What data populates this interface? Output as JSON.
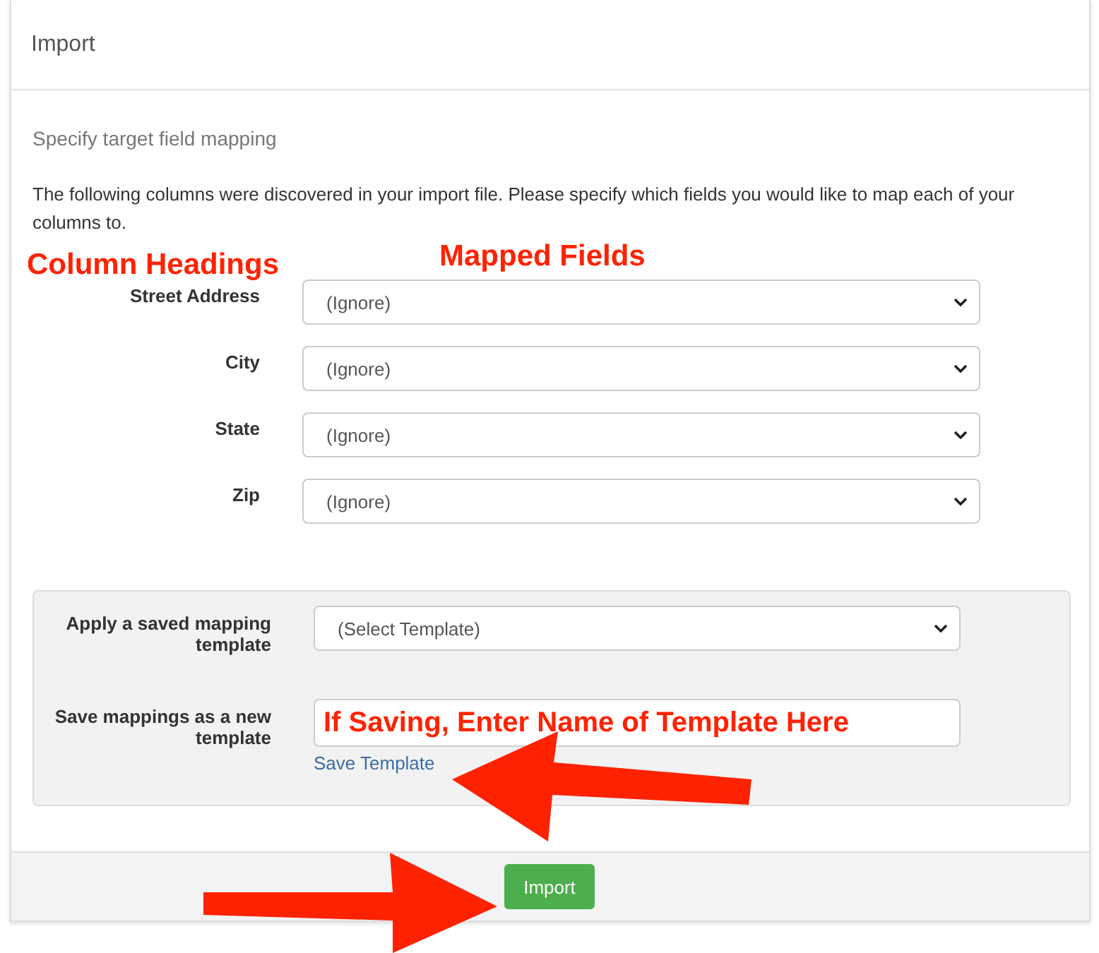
{
  "panel": {
    "title": "Import"
  },
  "section_title": "Specify target field mapping",
  "description": "The following columns were discovered in your import file. Please specify which fields you would like to map each of your columns to.",
  "annotations": {
    "column_label": "Column Headings",
    "field_label": "Mapped Fields"
  },
  "mappings": [
    {
      "column": "Street Address",
      "value": "(Ignore)"
    },
    {
      "column": "City",
      "value": "(Ignore)"
    },
    {
      "column": "State",
      "value": "(Ignore)"
    },
    {
      "column": "Zip",
      "value": "(Ignore)"
    }
  ],
  "template": {
    "apply_label": "Apply a saved mapping template",
    "apply_value": "(Select Template)",
    "save_label": "Save mappings as a new template",
    "save_value": "If Saving, Enter Name of Template Here",
    "save_link": "Save Template"
  },
  "footer": {
    "button": "Import"
  }
}
